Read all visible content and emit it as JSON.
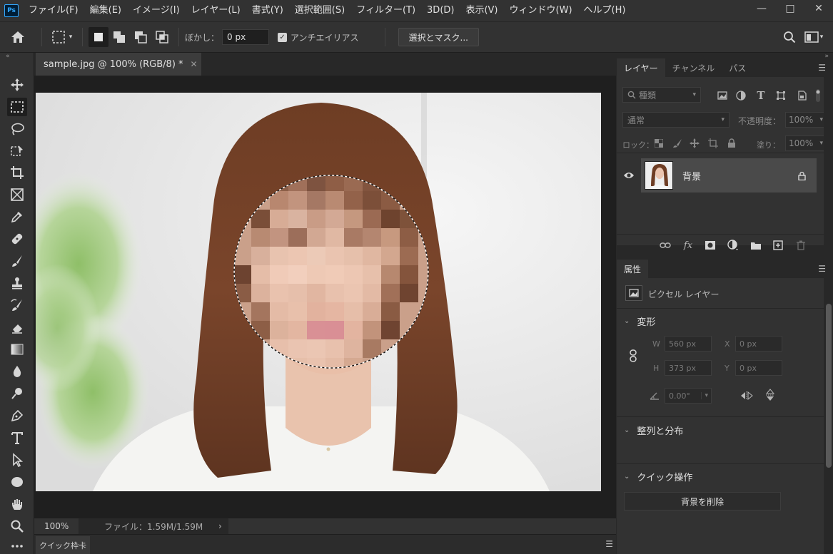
{
  "menubar": {
    "logo": "Ps",
    "items": [
      "ファイル(F)",
      "編集(E)",
      "イメージ(I)",
      "レイヤー(L)",
      "書式(Y)",
      "選択範囲(S)",
      "フィルター(T)",
      "3D(D)",
      "表示(V)",
      "ウィンドウ(W)",
      "ヘルプ(H)"
    ],
    "window_controls": [
      "minimize-icon",
      "maximize-icon",
      "close-icon"
    ]
  },
  "options": {
    "feather_label": "ぼかし：",
    "feather_value": "0 px",
    "antialias_label": "アンチエイリアス",
    "antialias_checked": true,
    "select_mask_label": "選択とマスク..."
  },
  "document": {
    "tab_title": "sample.jpg @ 100% (RGB/8) *",
    "zoom": "100%",
    "file_info": "ファイル：1.59M/1.59M"
  },
  "quick_tab": "クイック枠卡",
  "layers_panel": {
    "tabs": [
      "レイヤー",
      "チャンネル",
      "パス"
    ],
    "active_tab": "レイヤー",
    "filter_placeholder": "種類",
    "blend_mode": "通常",
    "opacity_label": "不透明度：",
    "opacity_value": "100%",
    "lock_label": "ロック：",
    "fill_label": "塗り：",
    "fill_value": "100%",
    "layers": [
      {
        "name": "背景",
        "visible": true,
        "locked": true
      }
    ]
  },
  "properties_panel": {
    "tab": "属性",
    "layer_type": "ピクセル レイヤー",
    "transform_title": "変形",
    "w_label": "W",
    "w_value": "560 px",
    "h_label": "H",
    "h_value": "373 px",
    "x_label": "X",
    "x_value": "0 px",
    "y_label": "Y",
    "y_value": "0 px",
    "angle_value": "0.00°",
    "align_title": "整列と分布",
    "quick_actions_title": "クイック操作",
    "remove_bg_label": "背景を削除"
  },
  "colors": {
    "accent": "#31a8ff",
    "panel": "#323232",
    "background": "#282828"
  }
}
